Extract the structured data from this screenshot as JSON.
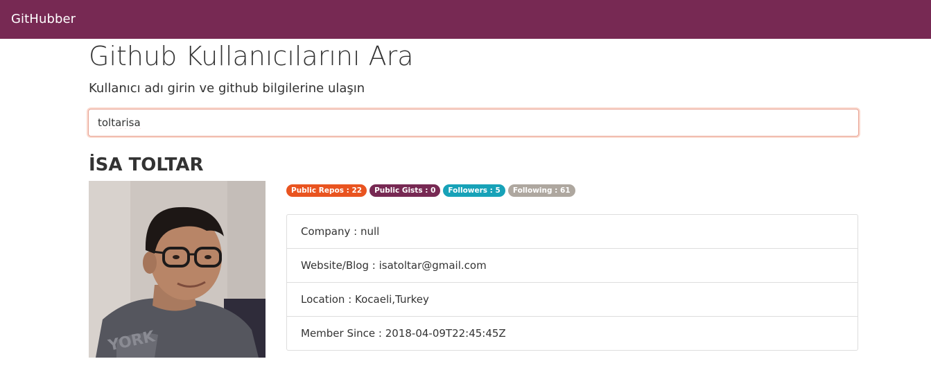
{
  "colors": {
    "navbar": "#772953",
    "badge_repos": "#e95420",
    "badge_gists": "#772953",
    "badge_followers": "#17a2b8",
    "badge_following": "#aea79f"
  },
  "navbar": {
    "brand": "GitHubber"
  },
  "header": {
    "title": "Github Kullanıcılarını Ara",
    "subtitle": "Kullanıcı adı girin ve github bilgilerine ulaşın"
  },
  "search": {
    "value": "toltarisa"
  },
  "profile": {
    "name": "İSA TOLTAR",
    "avatar_icon": "user-avatar-photo",
    "badges": [
      {
        "label": "Public Repos : 22"
      },
      {
        "label": "Public Gists : 0"
      },
      {
        "label": "Followers : 5"
      },
      {
        "label": "Following : 61"
      }
    ],
    "details": [
      {
        "text": "Company : null"
      },
      {
        "text": "Website/Blog : isatoltar@gmail.com"
      },
      {
        "text": "Location : Kocaeli,Turkey"
      },
      {
        "text": "Member Since : 2018-04-09T22:45:45Z"
      }
    ]
  }
}
